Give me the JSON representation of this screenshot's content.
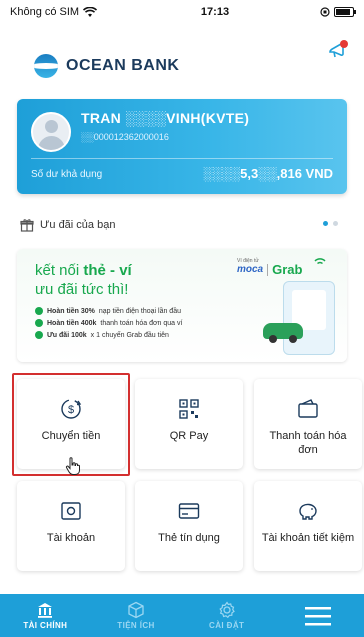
{
  "status_bar": {
    "carrier": "Không có SIM",
    "time": "17:13"
  },
  "header": {
    "brand_name": "OCEAN BANK",
    "icons": [
      "ocean-bank-logo",
      "notification-icon"
    ]
  },
  "account_card": {
    "name": "TRAN ░░░░VINH(KVTE)",
    "account_number": "░░000012362000016",
    "balance_label": "Số dư khả dụng",
    "balance_value": "░░░░5,3░░,816 VND"
  },
  "offers": {
    "label": "Ưu đãi của bạn",
    "page_count": 2,
    "active_page": 1
  },
  "promo_banner": {
    "headline_prefix": "kết nối ",
    "headline_bold": "thẻ - ví",
    "subheadline": "ưu đãi tức thì!",
    "items": [
      {
        "bold": "Hoàn tiền 30%",
        "text": " nạp tiền điện thoại lần đầu"
      },
      {
        "bold": "Hoàn tiền 400k",
        "text": " thanh toán hóa đơn qua ví"
      },
      {
        "bold": "Ưu đãi 100k",
        "text": " x 1 chuyến Grab đầu tiên"
      }
    ],
    "partner_caption": "Ví điện tử",
    "partner_1": "moca",
    "partner_2": "Grab"
  },
  "tiles": [
    {
      "label": "Chuyển tiền",
      "icon": "money-transfer-icon"
    },
    {
      "label": "QR Pay",
      "icon": "qr-code-icon"
    },
    {
      "label": "Thanh toán hóa đơn",
      "icon": "wallet-icon"
    },
    {
      "label": "Tài khoản",
      "icon": "account-card-icon"
    },
    {
      "label": "Thẻ tín dụng",
      "icon": "credit-card-icon"
    },
    {
      "label": "Tài khoản tiết kiệm",
      "icon": "piggy-bank-icon"
    }
  ],
  "tabbar": {
    "tabs": [
      {
        "label": "TÀI CHÍNH",
        "icon": "bank-icon",
        "active": true
      },
      {
        "label": "TIỆN ÍCH",
        "icon": "box-icon",
        "active": false
      },
      {
        "label": "CÀI ĐẶT",
        "icon": "gear-icon",
        "active": false
      }
    ],
    "menu_icon": "hamburger-menu-icon"
  },
  "colors": {
    "primary": "#1e9fd8",
    "promo_green": "#18a84e",
    "highlight_red": "#d32f2f",
    "brand_dark": "#1b3a5c"
  }
}
